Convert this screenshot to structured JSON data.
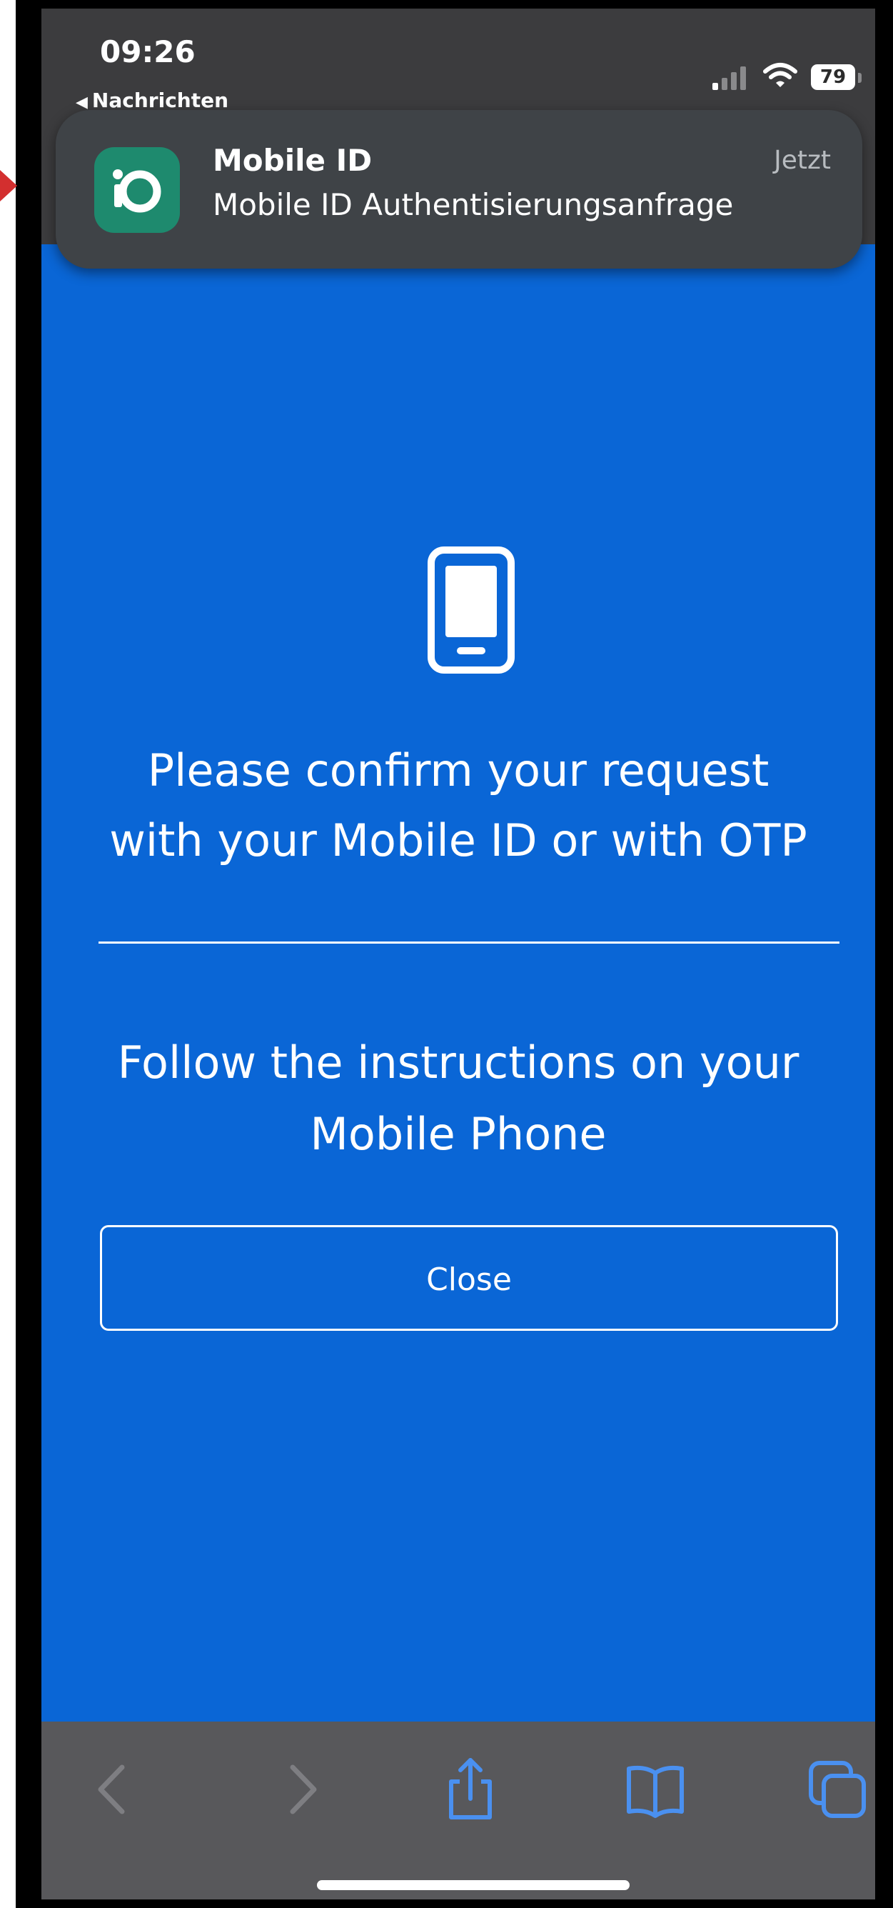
{
  "status_bar": {
    "time": "09:26",
    "back_app": "Nachrichten",
    "battery": "79"
  },
  "notification": {
    "app_name": "Mobile ID",
    "time": "Jetzt",
    "message": "Mobile ID Authentisierungsanfrage"
  },
  "content": {
    "heading_line1": "Please confirm your request",
    "heading_line2": "with your Mobile ID or with OTP",
    "instructions_line1": "Follow the instructions on your",
    "instructions_line2": "Mobile Phone",
    "close_label": "Close"
  },
  "toolbar": {
    "icons": [
      "back-icon",
      "forward-icon",
      "share-icon",
      "bookmarks-icon",
      "tabs-icon"
    ]
  },
  "colors": {
    "background": "#0a66d6",
    "notification_bg": "#3f4347",
    "app_icon": "#1e8a6e",
    "toolbar_bg": "#58585b",
    "toolbar_active": "#4a90f0",
    "toolbar_disabled": "#7e7e82",
    "annotation_arrow": "#d32f2f"
  }
}
